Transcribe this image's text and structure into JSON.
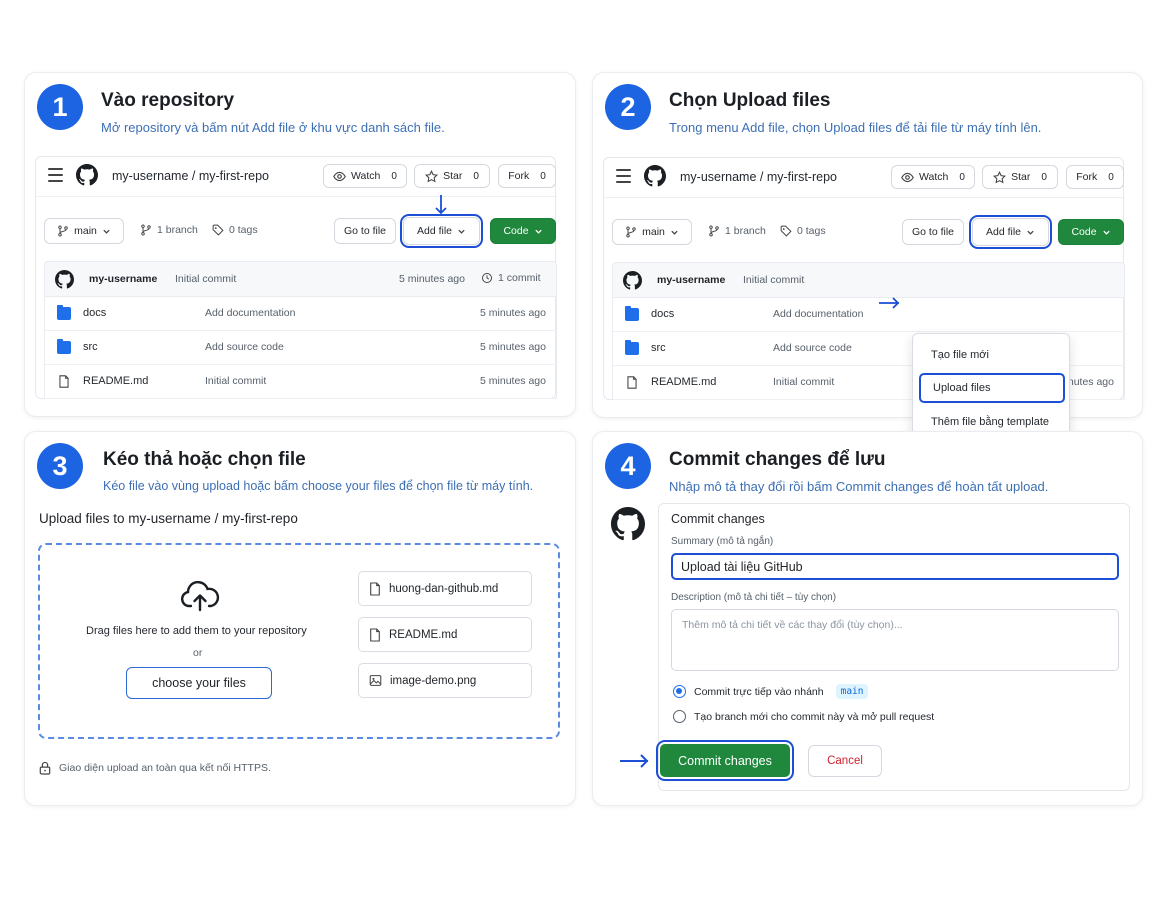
{
  "steps": [
    {
      "number": "1",
      "title": "Vào repository",
      "subtitle": "Mở repository và bấm nút Add file ở khu vực danh sách file."
    },
    {
      "number": "2",
      "title": "Chọn Upload files",
      "subtitle": "Trong menu Add file, chọn Upload files để tải file từ máy tính lên."
    },
    {
      "number": "3",
      "title": "Kéo thả hoặc chọn file",
      "subtitle": "Kéo file vào vùng upload hoặc bấm choose your files để chọn file từ máy tính."
    },
    {
      "number": "4",
      "title": "Commit changes để lưu",
      "subtitle": "Nhập mô tả thay đổi rồi bấm Commit changes để hoàn tất upload."
    }
  ],
  "repo": {
    "path": "my-username / my-first-repo",
    "watch_label": "Watch",
    "watch_count": "0",
    "star_label": "Star",
    "star_count": "0",
    "fork_label": "Fork",
    "fork_count": "0",
    "branch_select": "main",
    "branches": "1 branch",
    "tags": "0 tags",
    "go_to_file": "Go to file",
    "add_file": "Add file",
    "code": "Code",
    "latest_author": "my-username",
    "latest_message": "Initial commit",
    "latest_time": "5 minutes ago",
    "commits": "1 commit",
    "files": [
      {
        "name": "docs",
        "type": "folder",
        "message": "Add documentation",
        "time": "5 minutes ago"
      },
      {
        "name": "src",
        "type": "folder",
        "message": "Add source code",
        "time": "5 minutes ago"
      },
      {
        "name": "README.md",
        "type": "file",
        "message": "Initial commit",
        "time": "5 minutes ago"
      }
    ]
  },
  "add_menu": {
    "items": [
      "Tạo file mới",
      "Upload files",
      "Thêm file bằng template"
    ],
    "selected": "Upload files"
  },
  "upload": {
    "title": "Upload files to my-username / my-first-repo",
    "drag_text": "Drag files here to add them to your repository",
    "or": "or",
    "choose": "choose your files",
    "files": [
      "huong-dan-github.md",
      "README.md",
      "image-demo.png"
    ],
    "secure_note": "Giao diện upload an toàn qua kết nối HTTPS."
  },
  "commit": {
    "title": "Commit changes",
    "summary_label": "Summary (mô tả ngắn)",
    "summary_value": "Upload tài liệu GitHub",
    "description_label": "Description (mô tả chi tiết – tùy chọn)",
    "description_placeholder": "Thêm mô tả chi tiết về các thay đổi (tùy chọn)...",
    "option_direct": "Commit trực tiếp vào nhánh",
    "option_branch_name": "main",
    "option_new_branch": "Tạo branch mới cho commit này và mở pull request",
    "commit_button": "Commit changes",
    "cancel_button": "Cancel"
  },
  "colors": {
    "accent": "#1d64e3",
    "green": "#1f883d",
    "danger": "#cf222e",
    "folder": "#1f6feb"
  }
}
